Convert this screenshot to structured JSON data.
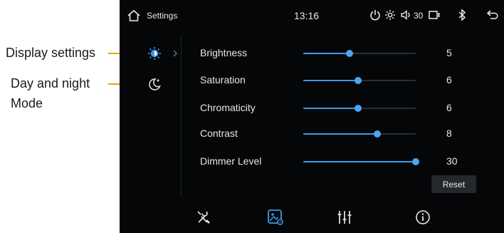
{
  "annotations": {
    "display_settings": "Display settings",
    "day_night_line1": "Day and night",
    "day_night_line2": "Mode"
  },
  "status_bar": {
    "home_icon": "home-icon",
    "title": "Settings",
    "time": "13:16",
    "volume": "30",
    "icons": [
      "power-icon",
      "brightness-icon",
      "speaker-icon",
      "screen-icon",
      "bluetooth-icon",
      "back-icon"
    ]
  },
  "sidebar": {
    "items": [
      {
        "icon": "display-settings-icon",
        "active": true
      },
      {
        "icon": "day-night-mode-icon",
        "active": false
      }
    ]
  },
  "settings": {
    "rows": [
      {
        "label": "Brightness",
        "value": "5",
        "level": 0.41
      },
      {
        "label": "Saturation",
        "value": "6",
        "level": 0.49
      },
      {
        "label": "Chromaticity",
        "value": "6",
        "level": 0.49
      },
      {
        "label": "Contrast",
        "value": "8",
        "level": 0.66
      },
      {
        "label": "Dimmer Level",
        "value": "30",
        "level": 1.0
      }
    ],
    "reset_label": "Reset"
  },
  "bottom_bar": {
    "items": [
      "tools-icon",
      "display-icon",
      "equalizer-icon",
      "info-icon"
    ],
    "active_index": 1
  },
  "colors": {
    "accent": "#3d9ae8",
    "background": "#050607",
    "callout_line": "#e0a51a"
  }
}
